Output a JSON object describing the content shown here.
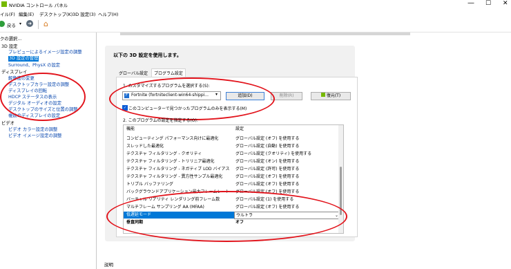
{
  "window": {
    "title": "NVIDIA コントロール パネル",
    "controls": [
      "minimize",
      "maximize",
      "close"
    ]
  },
  "menu": [
    "イル(F)",
    "編集(E)",
    "デスクトップ(K)",
    "3D 設定(3)",
    "ヘルプ(H)"
  ],
  "toolbar": {
    "back_label": "戻る"
  },
  "sidebar": {
    "header": "クの選択...",
    "groups": [
      {
        "label": "3D 設定",
        "items": [
          "プレビューによるイメージ設定の調整",
          "3D 設定の管理",
          "Surround、PhysX の設定"
        ],
        "selected": 1
      },
      {
        "label": "ディスプレイ",
        "items": [
          "解像度の変更",
          "デスクトップカラー設定の調整",
          "ディスプレイの回転",
          "HDCP ステータスの表示",
          "デジタル オーディオの設定",
          "デスクトップのサイズと位置の調整",
          "複数のディスプレイの設定"
        ]
      },
      {
        "label": "ビデオ",
        "items": [
          "ビデオ カラー設定の調整",
          "ビデオ イメージ設定の調整"
        ]
      }
    ]
  },
  "main": {
    "heading": "以下の 3D 設定を使用します。",
    "tabs": [
      "グローバル設定",
      "プログラム設定"
    ],
    "active_tab": 1,
    "step1_label": "1. カスタマイズするプログラムを選択する(S):",
    "program_selected": "Fortnite (fortniteclient-win64-shippi...",
    "add_button": "追加(D)",
    "remove_button": "削除(R)",
    "restore_button": "復元(T)",
    "show_only_checkbox": "このコンピューターで見つかったプログラムのみを表示する(M)",
    "show_only_checked": true,
    "step2_label": "2. このプログラムの設定を指定する(O):",
    "col_feature": "機能",
    "col_setting": "設定",
    "rows": [
      {
        "feature": "コンピューティング パフォーマンス向けに最適化",
        "setting": "グローバル設定 (オフ) を使用する"
      },
      {
        "feature": "スレッドした最適化",
        "setting": "グローバル設定 (自動) を使用する"
      },
      {
        "feature": "テクスチャ フィルタリング - クオリティ",
        "setting": "グローバル設定 (クオリティ) を使用する"
      },
      {
        "feature": "テクスチャ フィルタリング - トリリニア最適化",
        "setting": "グローバル設定 (オン) を使用する"
      },
      {
        "feature": "テクスチャ フィルタリング - ネガティブ LOD バイアス",
        "setting": "グローバル設定 (許可) を使用する"
      },
      {
        "feature": "テクスチャ フィルタリング - 異方性サンプル最適化",
        "setting": "グローバル設定 (オフ) を使用する"
      },
      {
        "feature": "トリプル バッファリング",
        "setting": "グローバル設定 (オフ) を使用する"
      },
      {
        "feature": "バックグラウンドアプリケーション最大フレームレート",
        "setting": "グローバル設定 (オフ) を使用する"
      },
      {
        "feature": "バーチャル リアリティ レンダリング前フレーム数",
        "setting": "グローバル設定 (1) を使用する"
      },
      {
        "feature": "マルチフレーム サンプリング AA (MFAA)",
        "setting": "グローバル設定 (オフ) を使用する"
      },
      {
        "feature": "低遅延モード",
        "setting": "ウルトラ"
      },
      {
        "feature": "垂直同期",
        "setting": "オフ"
      }
    ],
    "selected_row": 10,
    "description_label": "説明"
  }
}
